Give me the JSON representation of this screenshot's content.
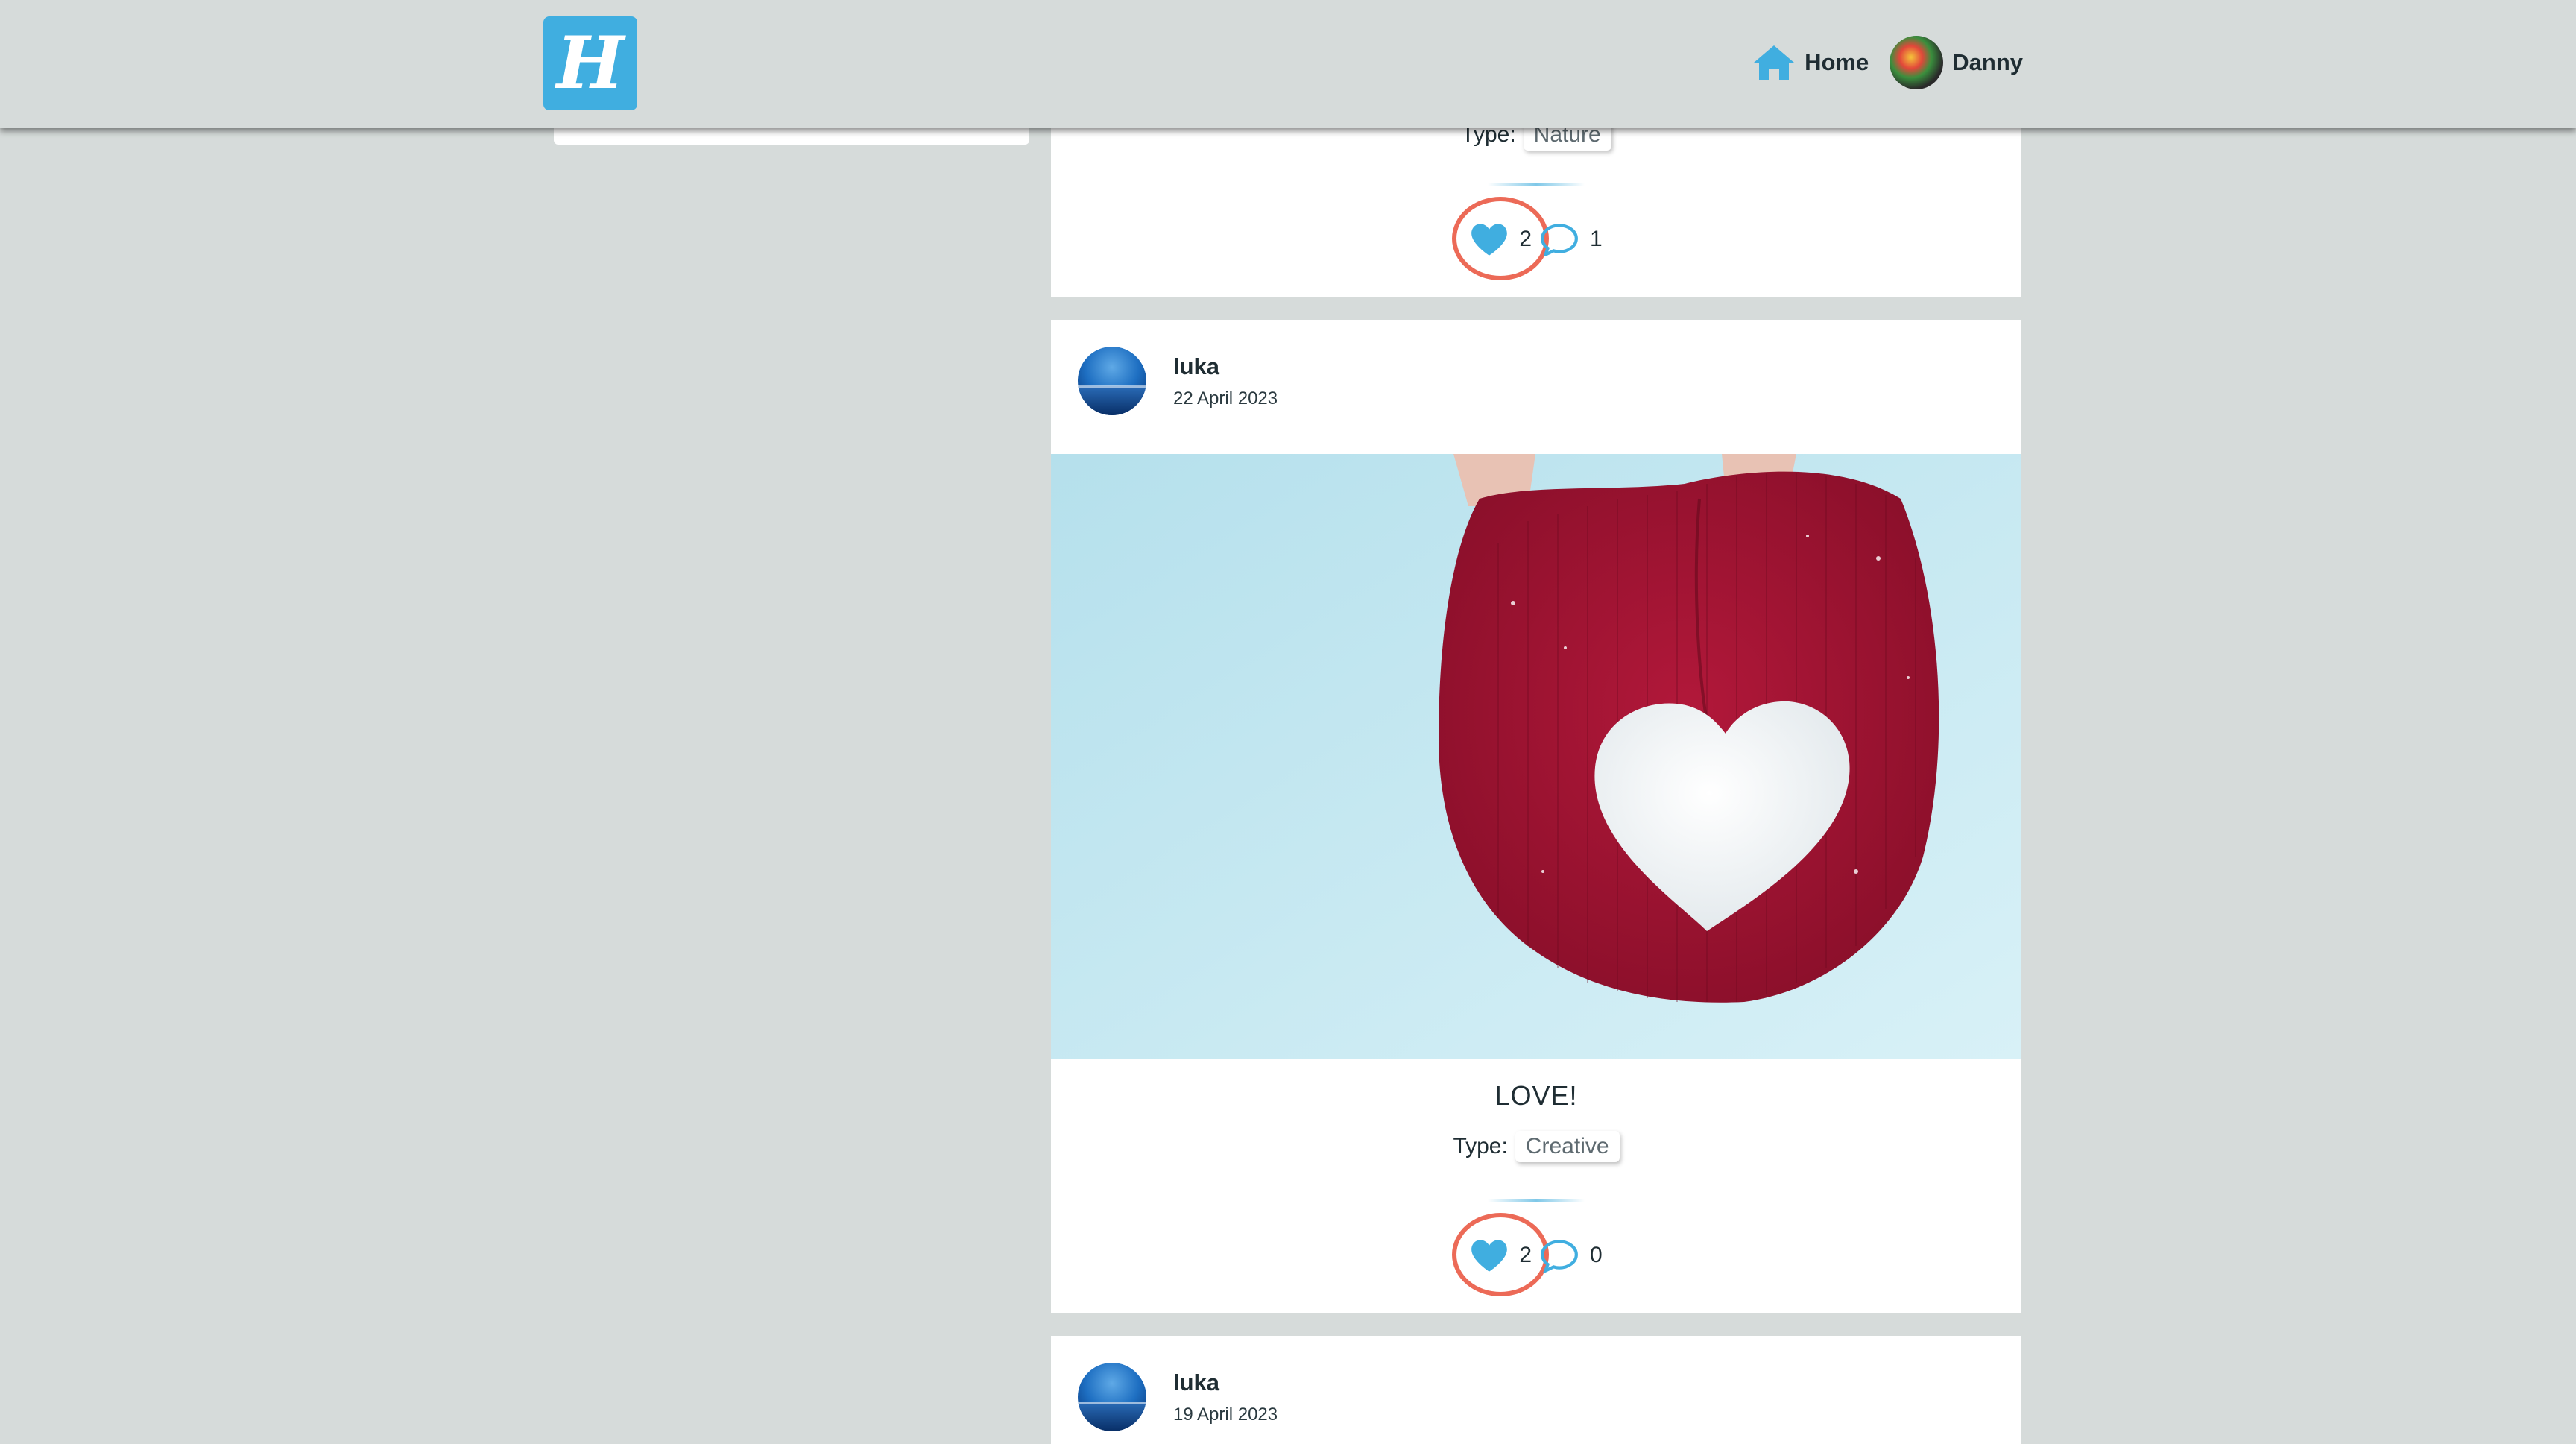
{
  "header": {
    "logo_letter": "H",
    "nav": {
      "home_label": "Home",
      "user_name": "Danny"
    }
  },
  "colors": {
    "accent": "#40aee0",
    "highlight_ring": "#ec6a57",
    "background": "#d6dbda"
  },
  "posts": [
    {
      "type_label": "Type:",
      "type_tag": "Nature",
      "likes": "2",
      "comments": "1"
    },
    {
      "author": "luka",
      "date": "22 April 2023",
      "title": "LOVE!",
      "type_label": "Type:",
      "type_tag": "Creative",
      "likes": "2",
      "comments": "0"
    },
    {
      "author": "luka",
      "date": "19 April 2023"
    }
  ]
}
